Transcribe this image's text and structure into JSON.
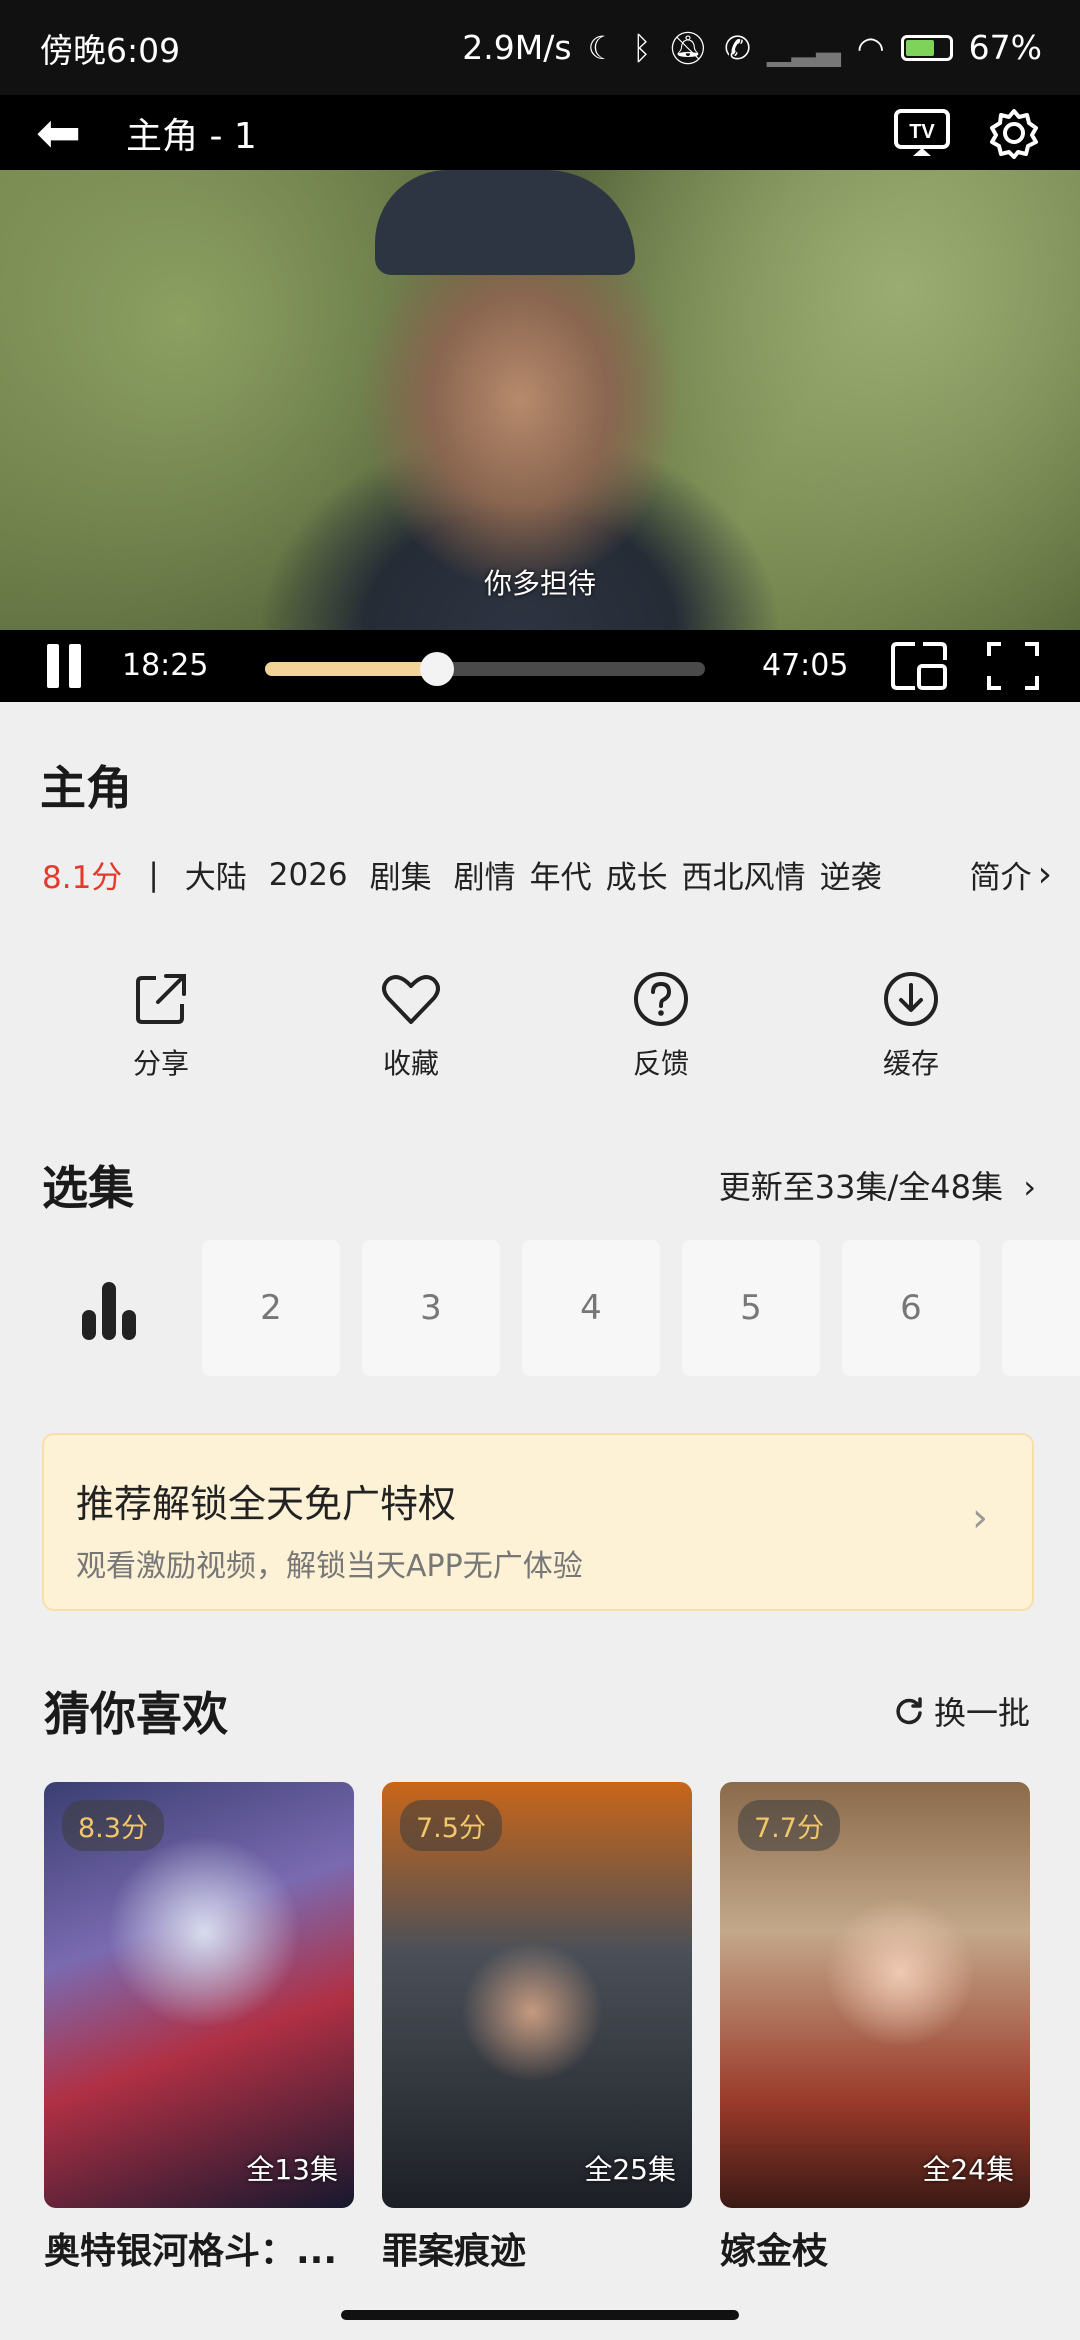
{
  "status_bar": {
    "time": "傍晚6:09",
    "network_speed": "2.9M/s",
    "battery": "67%"
  },
  "player": {
    "title": "主角 - 1",
    "subtitle": "你多担待",
    "current_time": "18:25",
    "total_time": "47:05",
    "progress": 0.391
  },
  "show": {
    "title": "主角",
    "rating": "8.1分",
    "separator": "|",
    "tags": [
      "大陆",
      "2026",
      "剧集",
      "剧情",
      "年代",
      "成长",
      "西北风情",
      "逆袭"
    ],
    "intro_label": "简介"
  },
  "actions": [
    {
      "label": "分享",
      "icon": "share-icon"
    },
    {
      "label": "收藏",
      "icon": "heart-icon"
    },
    {
      "label": "反馈",
      "icon": "question-icon"
    },
    {
      "label": "缓存",
      "icon": "download-icon"
    }
  ],
  "episodes": {
    "title": "选集",
    "more_label": "更新至33集/全48集",
    "items": [
      "2",
      "3",
      "4",
      "5",
      "6"
    ]
  },
  "promo": {
    "title": "推荐解锁全天免广特权",
    "subtitle": "观看激励视频，解锁当天APP无广体验"
  },
  "recommendations": {
    "title": "猜你喜欢",
    "refresh_label": "换一批",
    "items": [
      {
        "title": "奥特银河格斗：...",
        "score": "8.3分",
        "episodes": "全13集"
      },
      {
        "title": "罪案痕迹",
        "score": "7.5分",
        "episodes": "全25集"
      },
      {
        "title": "嫁金枝",
        "score": "7.7分",
        "episodes": "全24集"
      }
    ]
  },
  "colors": {
    "rating_red": "#e33a2c",
    "progress_gold": "#f2d398",
    "promo_bg": "#fdf1d6"
  }
}
